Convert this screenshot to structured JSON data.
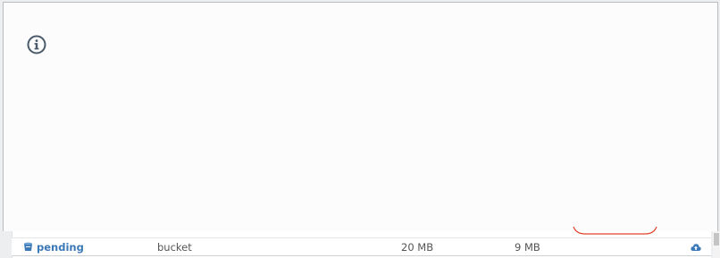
{
  "info": {
    "icon": "info-circle-icon"
  },
  "table": {
    "rows": [
      {
        "icon": "bucket-icon",
        "name": "pending",
        "type": "bucket",
        "size": "20 MB",
        "usage": "9 MB",
        "action_icon": "cloud-upload-icon"
      }
    ]
  },
  "colors": {
    "link": "#3a78b7",
    "accent_curve": "#e0442a",
    "icon": "#4a5a6a"
  }
}
